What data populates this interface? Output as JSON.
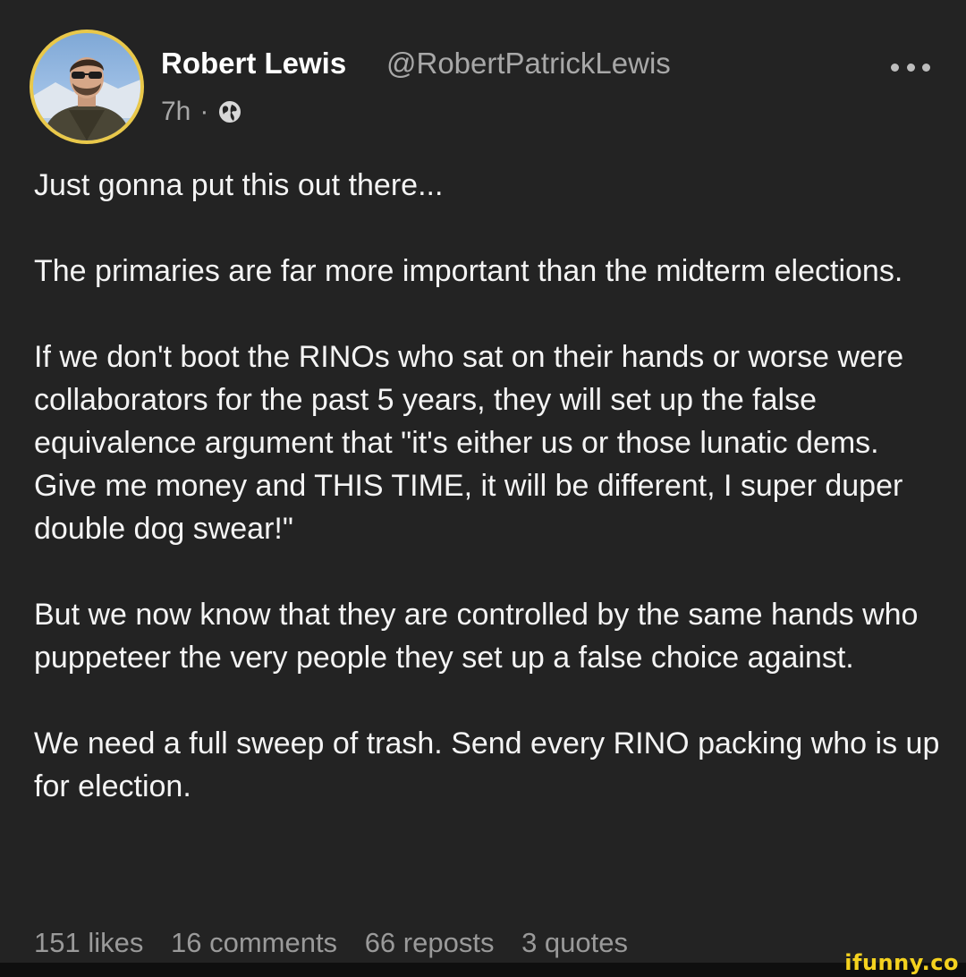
{
  "author": {
    "name": "Robert Lewis",
    "handle": "@RobertPatrickLewis"
  },
  "meta": {
    "time": "7h",
    "separator": "·",
    "visibility_icon": "globe-icon"
  },
  "menu_icon": "more-dots-icon",
  "post": {
    "paragraphs": [
      "Just gonna put this out there...",
      "The primaries are far more important than the midterm elections.",
      "If we don't boot the RINOs who sat on their hands or worse were collaborators for the past 5 years, they will set up the false equivalence argument that \"it's either us or those lunatic dems. Give me money and THIS TIME, it will be different, I super duper double dog swear!\"",
      "But we now know that they are controlled by the same hands who puppeteer the very people they set up a false choice against.",
      "We need a full sweep of trash. Send every RINO packing who is up for election."
    ]
  },
  "stats": {
    "likes": "151 likes",
    "comments": "16 comments",
    "reposts": "66 reposts",
    "quotes": "3 quotes"
  },
  "watermark": "ifunny.co",
  "colors": {
    "background": "#232323",
    "avatar_ring": "#e9c84a",
    "watermark": "#f4d21f"
  }
}
